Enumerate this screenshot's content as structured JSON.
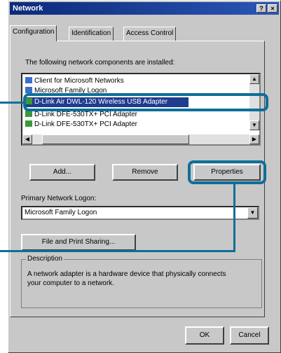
{
  "window": {
    "title": "Network",
    "help_label": "?",
    "close_label": "×"
  },
  "tabs": [
    "Configuration",
    "Identification",
    "Access Control"
  ],
  "components_label": "The following network components are installed:",
  "components": [
    {
      "label": "Client for Microsoft Networks",
      "icon_color": "#3a6fd0"
    },
    {
      "label": "Microsoft Family Logon",
      "icon_color": "#3a6fd0"
    },
    {
      "label": "D-Link Air DWL-120 Wireless USB Adapter",
      "icon_color": "#3a9a3a",
      "selected": true
    },
    {
      "label": "D-Link DFE-530TX+ PCI Adapter",
      "icon_color": "#3a9a3a"
    },
    {
      "label": "D-Link DFE-530TX+ PCI Adapter",
      "icon_color": "#3a9a3a"
    }
  ],
  "buttons": {
    "add": "Add...",
    "remove": "Remove",
    "properties": "Properties",
    "file_print": "File and Print Sharing...",
    "ok": "OK",
    "cancel": "Cancel"
  },
  "primary_logon": {
    "label": "Primary Network Logon:",
    "value": "Microsoft Family Logon"
  },
  "description": {
    "label": "Description",
    "text": "A network adapter is a hardware device that physically connects your computer to a network."
  },
  "colors": {
    "highlight": "#0d6f9a",
    "selection": "#1f3c8f",
    "dialog_bg": "#c8c8c8"
  }
}
